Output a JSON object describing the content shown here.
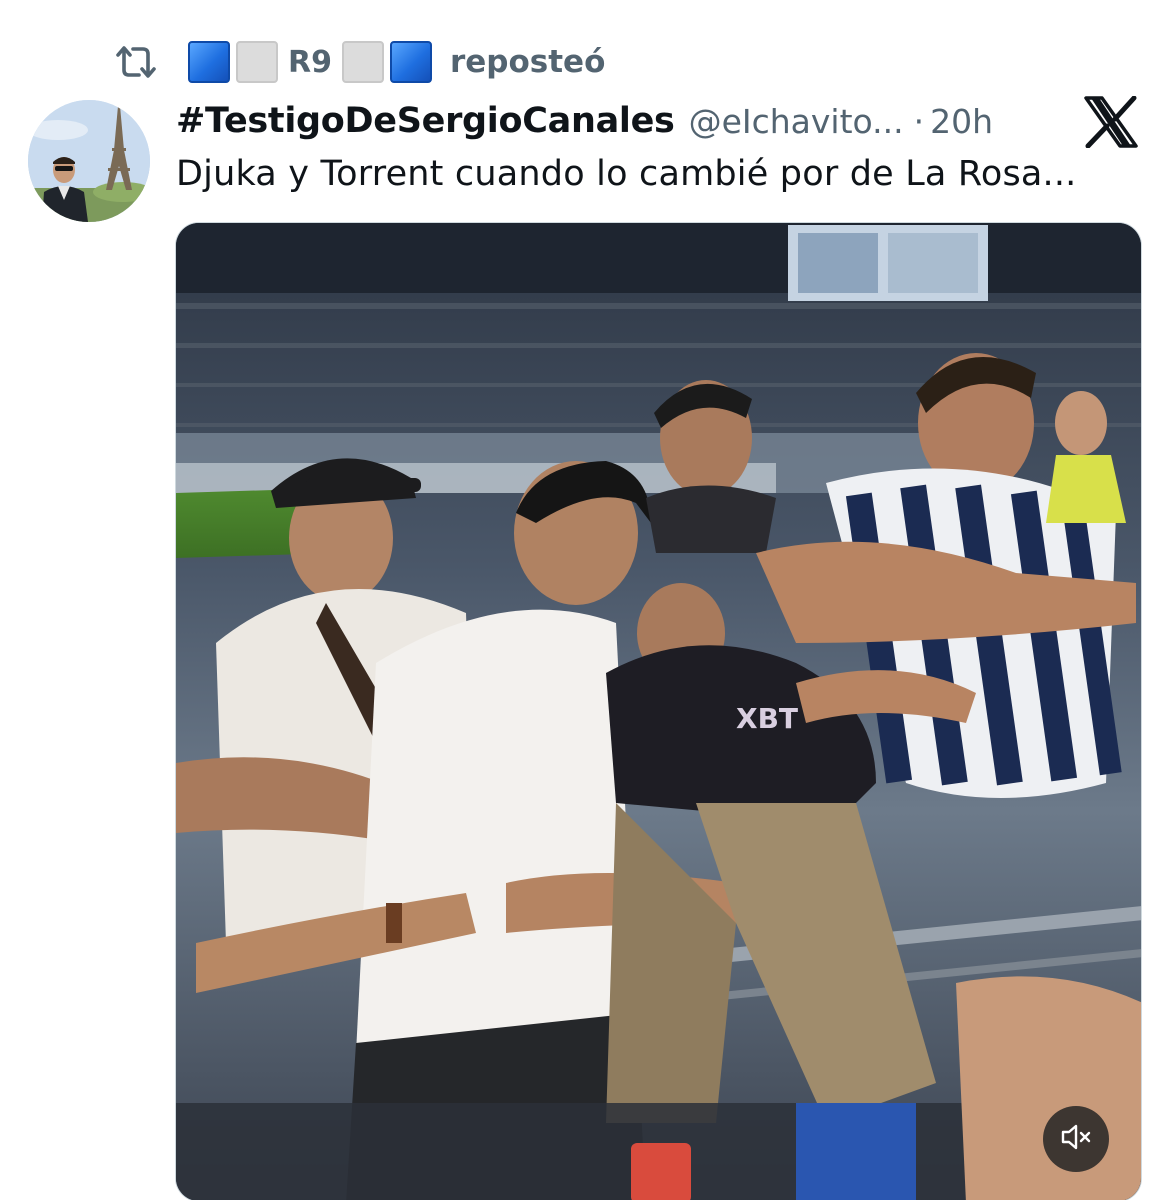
{
  "repost": {
    "icon": "repost-icon",
    "user_middle": "R9",
    "label": "reposteó",
    "emoji_blocks": [
      "blue",
      "gray",
      "gray",
      "blue"
    ]
  },
  "tweet": {
    "display_name": "#TestigoDeSergioCanales",
    "handle": "@eIchavito...",
    "separator": "·",
    "time": "20h",
    "text": "Djuka y Torrent cuando lo cambié por de La Rosa...",
    "brand_icon": "x-logo-icon"
  },
  "media": {
    "overlay_icon": "volume-muted-icon",
    "jersey_text": "XBT"
  },
  "colors": {
    "text_primary": "#0f1419",
    "text_secondary": "#536471",
    "emoji_blue": "#1f6fe0",
    "emoji_gray": "#dcdcdc"
  }
}
